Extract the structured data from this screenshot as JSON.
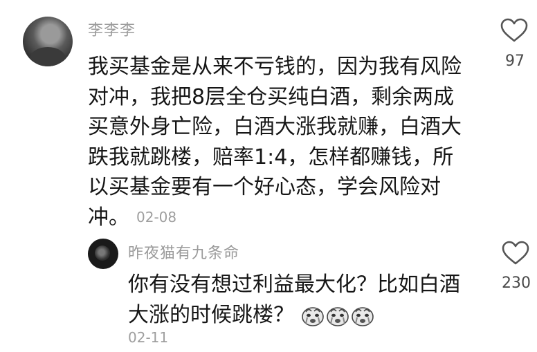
{
  "comment": {
    "username": "李李李",
    "text": "我买基金是从来不亏钱的，因为我有风险对冲，我把8层全仓买纯白酒，剩余两成买意外身亡险，白酒大涨我就赚，白酒大跌我就跳楼，赔率1:4，怎样都赚钱，所以买基金要有一个好心态，学会风险对冲。",
    "date": "02-08",
    "likes": "97"
  },
  "reply": {
    "username": "昨夜猫有九条命",
    "text": "你有没有想过利益最大化？比如白酒大涨的时候跳楼？",
    "emojis": [
      "crying-face-icon",
      "crying-face-icon",
      "crying-face-icon"
    ],
    "date": "02-11",
    "likes": "230"
  }
}
